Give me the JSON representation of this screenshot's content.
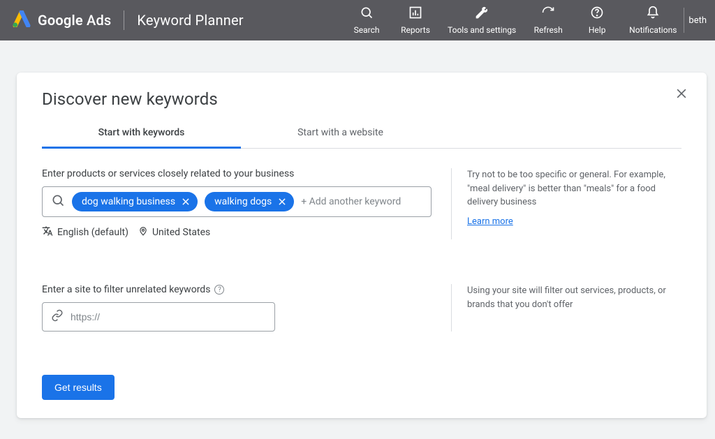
{
  "header": {
    "brand_strong": "Google",
    "brand_light": "Ads",
    "product": "Keyword Planner",
    "actions": {
      "search": "Search",
      "reports": "Reports",
      "tools": "Tools and settings",
      "refresh": "Refresh",
      "help": "Help",
      "notifications": "Notifications"
    },
    "user": "beth"
  },
  "card": {
    "title": "Discover new keywords",
    "tabs": {
      "keywords": "Start with keywords",
      "website": "Start with a website"
    },
    "keyword_section": {
      "label": "Enter products or services closely related to your business",
      "chips": [
        "dog walking business",
        "walking dogs"
      ],
      "add_placeholder": "+ Add another keyword",
      "language": "English (default)",
      "location": "United States",
      "hint": "Try not to be too specific or general. For example, \"meal delivery\" is better than \"meals\" for a food delivery business",
      "learn_more": "Learn more"
    },
    "site_section": {
      "label": "Enter a site to filter unrelated keywords",
      "placeholder": "https://",
      "hint": "Using your site will filter out services, products, or brands that you don't offer"
    },
    "get_results": "Get results"
  }
}
